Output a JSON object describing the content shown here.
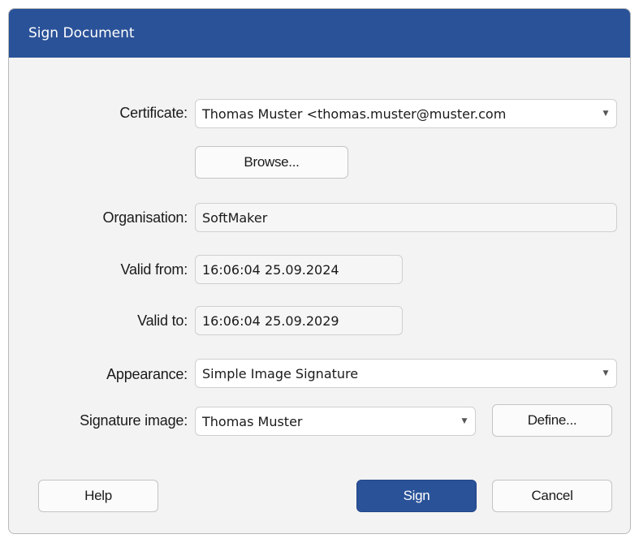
{
  "dialog": {
    "title": "Sign Document"
  },
  "certificate": {
    "label": "Certificate:",
    "value": "Thomas Muster <thomas.muster@muster.com",
    "browse_label": "Browse..."
  },
  "organisation": {
    "label": "Organisation:",
    "value": "SoftMaker"
  },
  "valid_from": {
    "label": "Valid from:",
    "value": "16:06:04 25.09.2024"
  },
  "valid_to": {
    "label": "Valid to:",
    "value": "16:06:04 25.09.2029"
  },
  "appearance": {
    "label": "Appearance:",
    "value": "Simple Image Signature"
  },
  "signature_image": {
    "label": "Signature image:",
    "value": "Thomas Muster",
    "define_label": "Define..."
  },
  "footer": {
    "help_label": "Help",
    "sign_label": "Sign",
    "cancel_label": "Cancel"
  },
  "icons": {
    "dropdown": "chevron-down-icon"
  },
  "colors": {
    "accent": "#2a5298",
    "dialog_bg": "#f3f3f3"
  }
}
